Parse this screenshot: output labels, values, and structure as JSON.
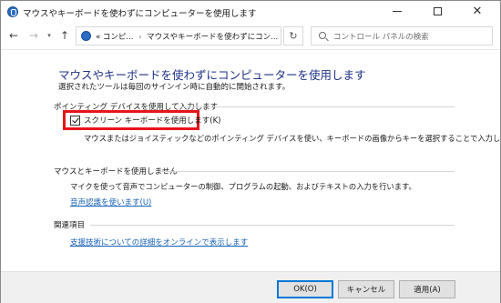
{
  "window": {
    "title": "マウスやキーボードを使わずにコンピューターを使用します",
    "minimize_glyph": "",
    "close_glyph": "✕"
  },
  "nav": {
    "back_glyph": "←",
    "forward_glyph": "→",
    "dropdown_glyph": "▾",
    "up_glyph": "↑",
    "breadcrumb": [
      "«",
      "コンピ...",
      "マウスやキーボードを使わずにコン..."
    ],
    "address_dropdown_glyph": "▾",
    "refresh_glyph": "↻",
    "search_placeholder": "コントロール パネルの検索"
  },
  "content": {
    "title": "マウスやキーボードを使わずにコンピューターを使用します",
    "subtitle": "選択されたツールは毎回のサインイン時に自動的に開始されます。",
    "section_pointing": {
      "label": "ポインティング デバイスを使用して入力します",
      "checkbox_label": "スクリーン キーボードを使用します(K)",
      "checked": true,
      "description": "マウスまたはジョイスティックなどのポインティング デバイスを使い、キーボードの画像からキーを選択することで入力します。"
    },
    "section_no_mouse": {
      "label": "マウスとキーボードを使用しません",
      "description": "マイクを使って音声でコンピューターの制御、プログラムの起動、およびテキストの入力を行います。",
      "link": "音声認識を使います(U)"
    },
    "section_related": {
      "label": "関連項目",
      "link": "支援技術についての詳細をオンラインで表示します"
    }
  },
  "footer": {
    "ok_label": "OK(O)",
    "cancel_label": "キャンセル",
    "apply_label": "適用(A)"
  },
  "colors": {
    "title_blue": "#1e3287",
    "link_blue": "#1662b8",
    "highlight_red": "#e8141b"
  }
}
